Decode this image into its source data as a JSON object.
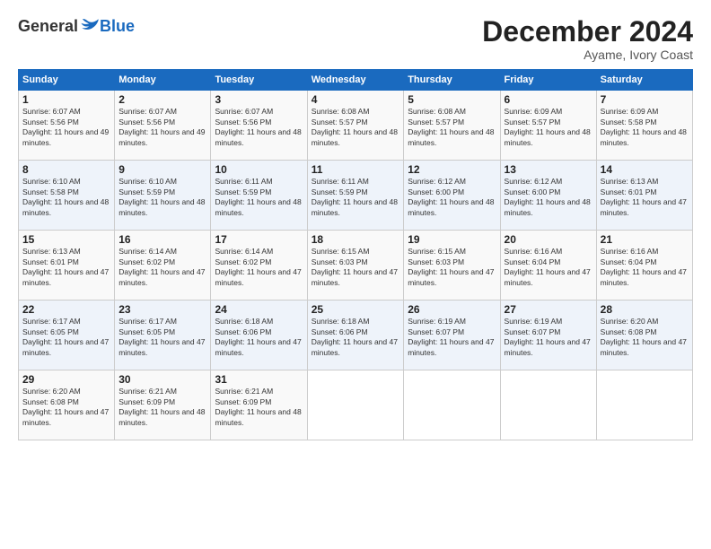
{
  "logo": {
    "general": "General",
    "blue": "Blue"
  },
  "header": {
    "title": "December 2024",
    "location": "Ayame, Ivory Coast"
  },
  "calendar": {
    "days_of_week": [
      "Sunday",
      "Monday",
      "Tuesday",
      "Wednesday",
      "Thursday",
      "Friday",
      "Saturday"
    ],
    "weeks": [
      [
        null,
        null,
        null,
        null,
        null,
        null,
        null
      ]
    ],
    "cells": [
      [
        {
          "day": null,
          "content": null
        },
        {
          "day": null,
          "content": null
        },
        {
          "day": null,
          "content": null
        },
        {
          "day": null,
          "content": null
        },
        {
          "day": null,
          "content": null
        },
        {
          "day": null,
          "content": null
        },
        {
          "day": null,
          "content": null
        }
      ]
    ]
  },
  "weeks": [
    [
      {
        "day": "1",
        "sunrise": "Sunrise: 6:07 AM",
        "sunset": "Sunset: 5:56 PM",
        "daylight": "Daylight: 11 hours and 49 minutes."
      },
      {
        "day": "2",
        "sunrise": "Sunrise: 6:07 AM",
        "sunset": "Sunset: 5:56 PM",
        "daylight": "Daylight: 11 hours and 49 minutes."
      },
      {
        "day": "3",
        "sunrise": "Sunrise: 6:07 AM",
        "sunset": "Sunset: 5:56 PM",
        "daylight": "Daylight: 11 hours and 48 minutes."
      },
      {
        "day": "4",
        "sunrise": "Sunrise: 6:08 AM",
        "sunset": "Sunset: 5:57 PM",
        "daylight": "Daylight: 11 hours and 48 minutes."
      },
      {
        "day": "5",
        "sunrise": "Sunrise: 6:08 AM",
        "sunset": "Sunset: 5:57 PM",
        "daylight": "Daylight: 11 hours and 48 minutes."
      },
      {
        "day": "6",
        "sunrise": "Sunrise: 6:09 AM",
        "sunset": "Sunset: 5:57 PM",
        "daylight": "Daylight: 11 hours and 48 minutes."
      },
      {
        "day": "7",
        "sunrise": "Sunrise: 6:09 AM",
        "sunset": "Sunset: 5:58 PM",
        "daylight": "Daylight: 11 hours and 48 minutes."
      }
    ],
    [
      {
        "day": "8",
        "sunrise": "Sunrise: 6:10 AM",
        "sunset": "Sunset: 5:58 PM",
        "daylight": "Daylight: 11 hours and 48 minutes."
      },
      {
        "day": "9",
        "sunrise": "Sunrise: 6:10 AM",
        "sunset": "Sunset: 5:59 PM",
        "daylight": "Daylight: 11 hours and 48 minutes."
      },
      {
        "day": "10",
        "sunrise": "Sunrise: 6:11 AM",
        "sunset": "Sunset: 5:59 PM",
        "daylight": "Daylight: 11 hours and 48 minutes."
      },
      {
        "day": "11",
        "sunrise": "Sunrise: 6:11 AM",
        "sunset": "Sunset: 5:59 PM",
        "daylight": "Daylight: 11 hours and 48 minutes."
      },
      {
        "day": "12",
        "sunrise": "Sunrise: 6:12 AM",
        "sunset": "Sunset: 6:00 PM",
        "daylight": "Daylight: 11 hours and 48 minutes."
      },
      {
        "day": "13",
        "sunrise": "Sunrise: 6:12 AM",
        "sunset": "Sunset: 6:00 PM",
        "daylight": "Daylight: 11 hours and 48 minutes."
      },
      {
        "day": "14",
        "sunrise": "Sunrise: 6:13 AM",
        "sunset": "Sunset: 6:01 PM",
        "daylight": "Daylight: 11 hours and 47 minutes."
      }
    ],
    [
      {
        "day": "15",
        "sunrise": "Sunrise: 6:13 AM",
        "sunset": "Sunset: 6:01 PM",
        "daylight": "Daylight: 11 hours and 47 minutes."
      },
      {
        "day": "16",
        "sunrise": "Sunrise: 6:14 AM",
        "sunset": "Sunset: 6:02 PM",
        "daylight": "Daylight: 11 hours and 47 minutes."
      },
      {
        "day": "17",
        "sunrise": "Sunrise: 6:14 AM",
        "sunset": "Sunset: 6:02 PM",
        "daylight": "Daylight: 11 hours and 47 minutes."
      },
      {
        "day": "18",
        "sunrise": "Sunrise: 6:15 AM",
        "sunset": "Sunset: 6:03 PM",
        "daylight": "Daylight: 11 hours and 47 minutes."
      },
      {
        "day": "19",
        "sunrise": "Sunrise: 6:15 AM",
        "sunset": "Sunset: 6:03 PM",
        "daylight": "Daylight: 11 hours and 47 minutes."
      },
      {
        "day": "20",
        "sunrise": "Sunrise: 6:16 AM",
        "sunset": "Sunset: 6:04 PM",
        "daylight": "Daylight: 11 hours and 47 minutes."
      },
      {
        "day": "21",
        "sunrise": "Sunrise: 6:16 AM",
        "sunset": "Sunset: 6:04 PM",
        "daylight": "Daylight: 11 hours and 47 minutes."
      }
    ],
    [
      {
        "day": "22",
        "sunrise": "Sunrise: 6:17 AM",
        "sunset": "Sunset: 6:05 PM",
        "daylight": "Daylight: 11 hours and 47 minutes."
      },
      {
        "day": "23",
        "sunrise": "Sunrise: 6:17 AM",
        "sunset": "Sunset: 6:05 PM",
        "daylight": "Daylight: 11 hours and 47 minutes."
      },
      {
        "day": "24",
        "sunrise": "Sunrise: 6:18 AM",
        "sunset": "Sunset: 6:06 PM",
        "daylight": "Daylight: 11 hours and 47 minutes."
      },
      {
        "day": "25",
        "sunrise": "Sunrise: 6:18 AM",
        "sunset": "Sunset: 6:06 PM",
        "daylight": "Daylight: 11 hours and 47 minutes."
      },
      {
        "day": "26",
        "sunrise": "Sunrise: 6:19 AM",
        "sunset": "Sunset: 6:07 PM",
        "daylight": "Daylight: 11 hours and 47 minutes."
      },
      {
        "day": "27",
        "sunrise": "Sunrise: 6:19 AM",
        "sunset": "Sunset: 6:07 PM",
        "daylight": "Daylight: 11 hours and 47 minutes."
      },
      {
        "day": "28",
        "sunrise": "Sunrise: 6:20 AM",
        "sunset": "Sunset: 6:08 PM",
        "daylight": "Daylight: 11 hours and 47 minutes."
      }
    ],
    [
      {
        "day": "29",
        "sunrise": "Sunrise: 6:20 AM",
        "sunset": "Sunset: 6:08 PM",
        "daylight": "Daylight: 11 hours and 47 minutes."
      },
      {
        "day": "30",
        "sunrise": "Sunrise: 6:21 AM",
        "sunset": "Sunset: 6:09 PM",
        "daylight": "Daylight: 11 hours and 48 minutes."
      },
      {
        "day": "31",
        "sunrise": "Sunrise: 6:21 AM",
        "sunset": "Sunset: 6:09 PM",
        "daylight": "Daylight: 11 hours and 48 minutes."
      },
      null,
      null,
      null,
      null
    ]
  ],
  "days_of_week": [
    "Sunday",
    "Monday",
    "Tuesday",
    "Wednesday",
    "Thursday",
    "Friday",
    "Saturday"
  ]
}
